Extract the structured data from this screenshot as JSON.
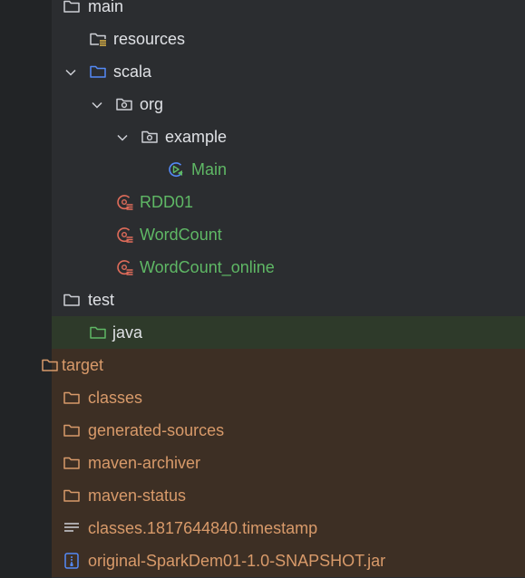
{
  "tree": {
    "main": "main",
    "resources": "resources",
    "scala": "scala",
    "org": "org",
    "example": "example",
    "main_object": "Main",
    "rdd01": "RDD01",
    "wordcount": "WordCount",
    "wordcount_online": "WordCount_online",
    "test": "test",
    "java": "java",
    "target": "target",
    "classes": "classes",
    "generated_sources": "generated-sources",
    "maven_archiver": "maven-archiver",
    "maven_status": "maven-status",
    "timestamp_file": "classes.1817644840.timestamp",
    "jar_file": "original-SparkDem01-1.0-SNAPSHOT.jar"
  },
  "icons": {
    "folder": "folder-icon",
    "resources_folder": "resources-folder-icon",
    "source_folder": "source-folder-icon",
    "package": "package-icon",
    "test_folder": "test-source-folder-icon",
    "scala_object": "scala-object-icon",
    "runnable_object": "runnable-object-icon",
    "text_file": "text-file-icon",
    "jar": "jar-icon",
    "chevron": "chevron-down-icon"
  },
  "colors": {
    "background": "#2b2d30",
    "selected_row": "#2e3a2a",
    "excluded_row": "#3d2f24",
    "green_text": "#5fb865",
    "orange_text": "#d89a6a",
    "blue_folder": "#548af7",
    "scala_red": "#e06c5a"
  }
}
